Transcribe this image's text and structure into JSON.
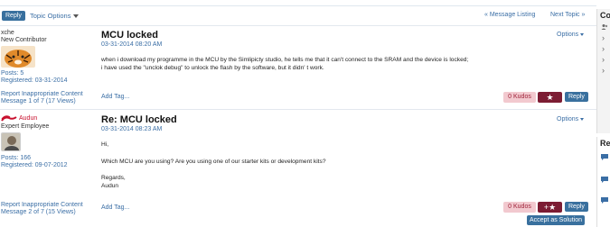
{
  "toolbar": {
    "reply_label": "Reply",
    "topic_options_label": "Topic Options",
    "prev_label": "« Message Listing",
    "next_label": "Next Topic »"
  },
  "posts": [
    {
      "author": "xche",
      "rank": "New Contributor",
      "posts_count": "Posts: 5",
      "registered": "Registered: 03-31-2014",
      "title": "MCU locked",
      "date": "03-31-2014 08:20 AM",
      "options_label": "Options",
      "body": [
        "when i download my programme in the MCU by the Simlipicty studio, he tells me that it can't connect to the SRAM and the device is locked;",
        "i have used  the \"unclok debug\"  to unlock the flash by the software, but it didn' t work."
      ],
      "report_label": "Report Inappropriate Content",
      "message_info": "Message 1 of 7 (17 Views)",
      "add_tag_label": "Add Tag...",
      "kudos_label": "0 Kudos",
      "reply_label": "Reply"
    },
    {
      "author": "Audun",
      "rank": "Expert Employee",
      "posts_count": "Posts: 166",
      "registered": "Registered: 09-07-2012",
      "title": "Re: MCU locked",
      "date": "03-31-2014 08:23 AM",
      "options_label": "Options",
      "body": [
        "Hi,",
        "Which MCU are you using? Are you using one of our starter kits or development kits?",
        "Regards,",
        "Audun"
      ],
      "report_label": "Report Inappropriate Content",
      "message_info": "Message 2 of 7 (15 Views)",
      "add_tag_label": "Add Tag...",
      "kudos_label": "0 Kudos",
      "reply_label": "Reply",
      "accept_label": "Accept as Solution"
    }
  ],
  "sidebar": {
    "head1": "Co",
    "head2": "Re"
  },
  "colors": {
    "accent": "#39709e",
    "kudos_bg": "#f2c9cf",
    "kudos_star": "#7c1c33",
    "link": "#3a6ea5"
  }
}
